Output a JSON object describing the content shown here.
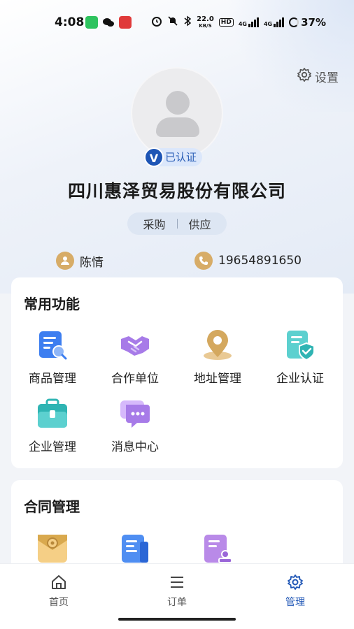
{
  "status_bar": {
    "time": "4:08",
    "net_speed_top": "22.0",
    "net_speed_unit": "KB/S",
    "hd_label": "HD",
    "sig1_label": "4G",
    "sig2_label": "4G",
    "battery": "37%"
  },
  "header": {
    "settings_label": "设置"
  },
  "profile": {
    "verified_label": "已认证",
    "verified_mark": "V",
    "company_name": "四川惠泽贸易股份有限公司",
    "roles": [
      "采购",
      "供应"
    ],
    "contact_name": "陈情",
    "phone": "19654891650"
  },
  "common_functions": {
    "title": "常用功能",
    "items": [
      {
        "label": "商品管理",
        "icon": "product-manage-icon"
      },
      {
        "label": "合作单位",
        "icon": "handshake-icon"
      },
      {
        "label": "地址管理",
        "icon": "location-pin-icon"
      },
      {
        "label": "企业认证",
        "icon": "certificate-shield-icon"
      },
      {
        "label": "企业管理",
        "icon": "briefcase-icon"
      },
      {
        "label": "消息中心",
        "icon": "chat-bubble-icon"
      }
    ]
  },
  "contract_management": {
    "title": "合同管理",
    "items": [
      {
        "icon": "contract-envelope-icon"
      },
      {
        "icon": "contract-document-icon"
      },
      {
        "icon": "contract-seal-icon"
      }
    ]
  },
  "tab_bar": {
    "tabs": [
      {
        "label": "首页",
        "icon": "home-icon"
      },
      {
        "label": "订单",
        "icon": "list-icon"
      },
      {
        "label": "管理",
        "icon": "gear-icon"
      }
    ],
    "active_color": "#1e55b5"
  },
  "colors": {
    "accent": "#1e55b5",
    "contact_icon": "#d7ac67"
  }
}
